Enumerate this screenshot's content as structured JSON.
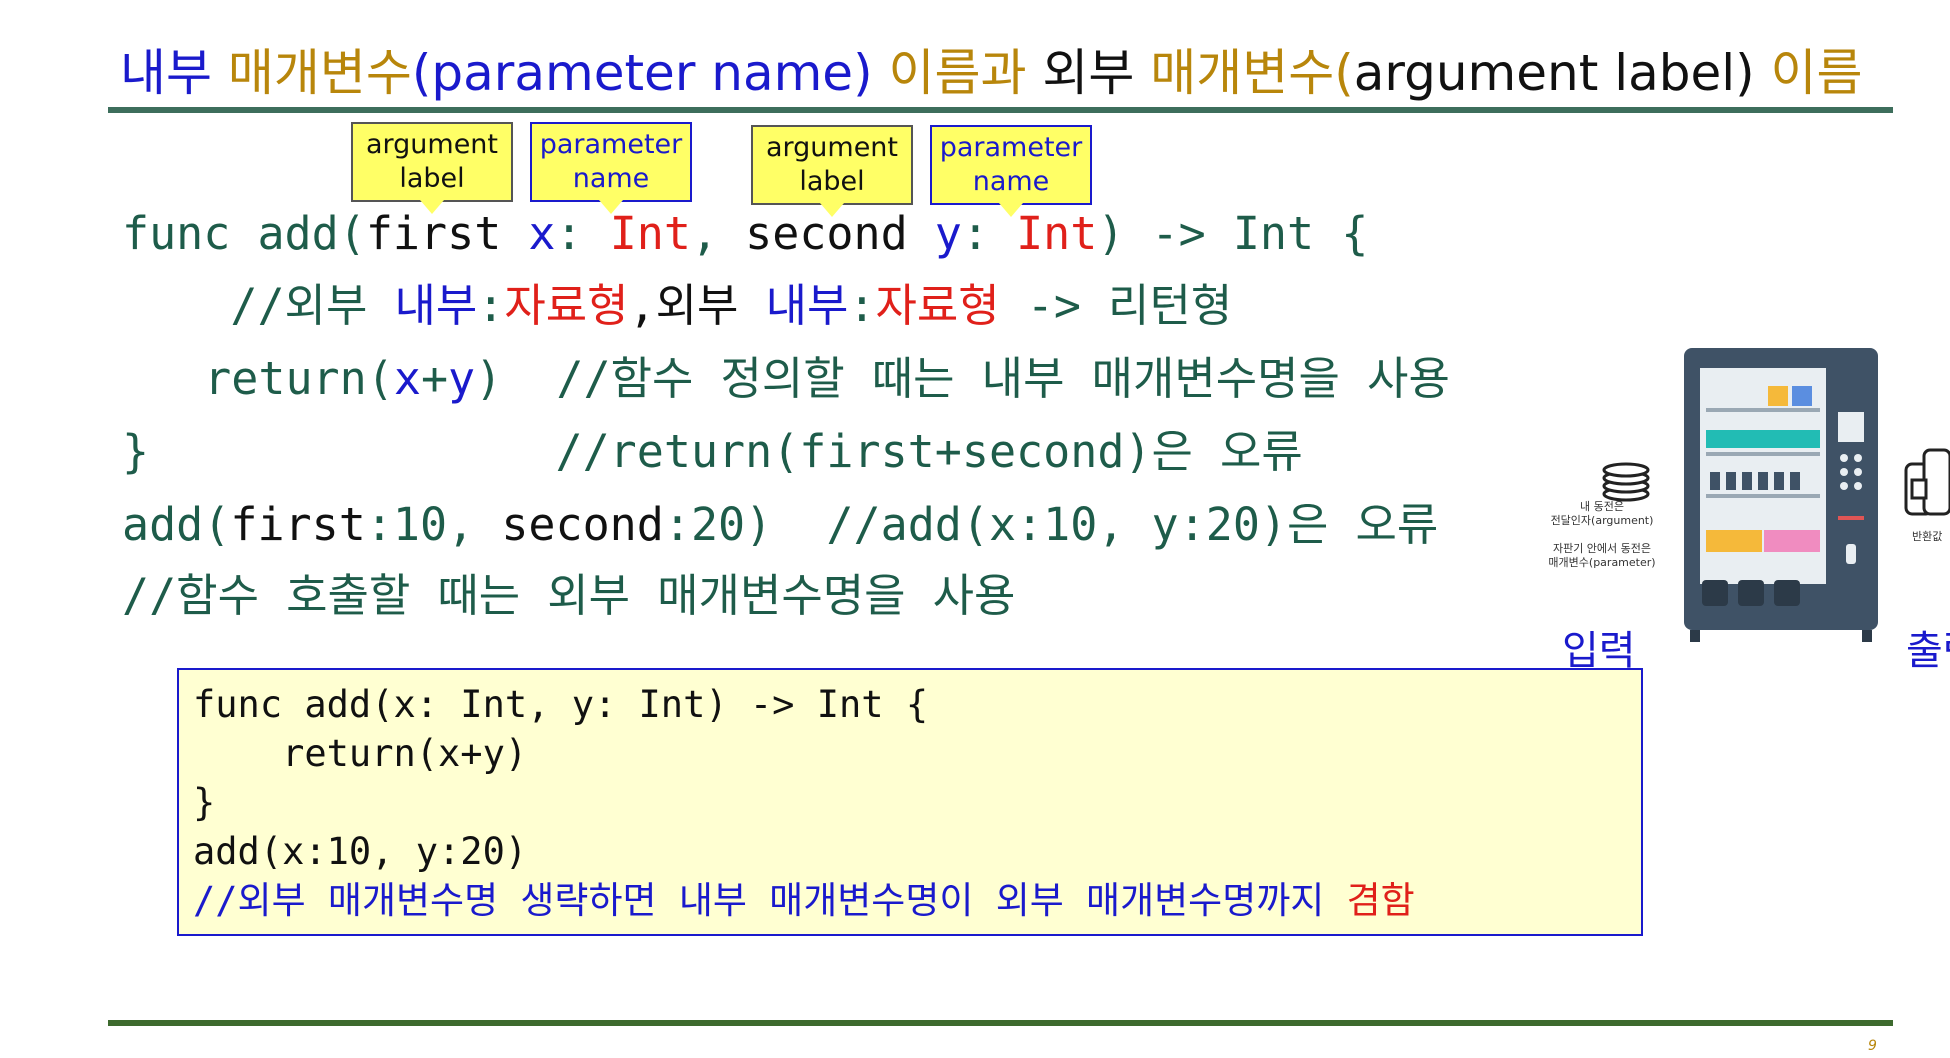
{
  "title": {
    "p1": "내부 ",
    "p2": "매개변수",
    "p3": "(parameter name) ",
    "p4": "이름과 ",
    "p5": "외부 ",
    "p6": "매개변수",
    "p7": "(",
    "p8": "argument label) ",
    "p9": "이름"
  },
  "callouts": {
    "c1_l1": "argument",
    "c1_l2": "label",
    "c2_l1": "parameter",
    "c2_l2": "name",
    "c3_l1": "argument",
    "c3_l2": "label",
    "c4_l1": "parameter",
    "c4_l2": "name"
  },
  "code": {
    "l1": {
      "a": "func add(",
      "b": "first",
      "c": " x",
      "d": ": ",
      "e": "Int",
      "f": ", ",
      "g": "second",
      "h": " y",
      "i": ": ",
      "j": "Int",
      "k": ") -> Int {"
    },
    "l2": {
      "a": "    //외부 ",
      "b": "내부",
      "c": ":",
      "d": "자료형",
      "e": ",외부 ",
      "f": "내부",
      "g": ":",
      "h": "자료형",
      "i": " -> 리턴형"
    },
    "l3": {
      "a": "  return(",
      "b": "x",
      "c": "+",
      "d": "y",
      "e": ")  //함수 정의할 때는 내부 매개변수명을 사용"
    },
    "l4": {
      "a": "}               //return(first+second)은 오류"
    },
    "l5": {
      "a": "add(",
      "b": "first",
      "c": ":10, ",
      "d": "second",
      "e": ":20)  //add(x:10, y:20)은 오류"
    },
    "l6": {
      "a": "//함수 호출할 때는 외부 매개변수명을 사용"
    }
  },
  "box": {
    "l1": "func add(x: Int, y: Int) -> Int {",
    "l2": "    return(x+y)",
    "l3": "}",
    "l4": "add(x:10, y:20)",
    "l5a": "//외부 매개변수명 생략하면 내부 매개변수명이 외부 매개변수명까지 ",
    "l5b": "겸함"
  },
  "vending": {
    "note1_a": "내 동전은",
    "note1_b": "전달인자(argument)",
    "note2_a": "자판기 안에서 동전은",
    "note2_b": "매개변수(parameter)",
    "note3": "반환값",
    "input_label": "입력",
    "output_label": "출력"
  },
  "page_number": "9",
  "colors": {
    "blue": "#1a1acc",
    "gold": "#b8860b",
    "green": "#1e5c4a",
    "red": "#e0201a",
    "callout_fill": "#ffff66",
    "box_fill": "#ffffd2"
  }
}
